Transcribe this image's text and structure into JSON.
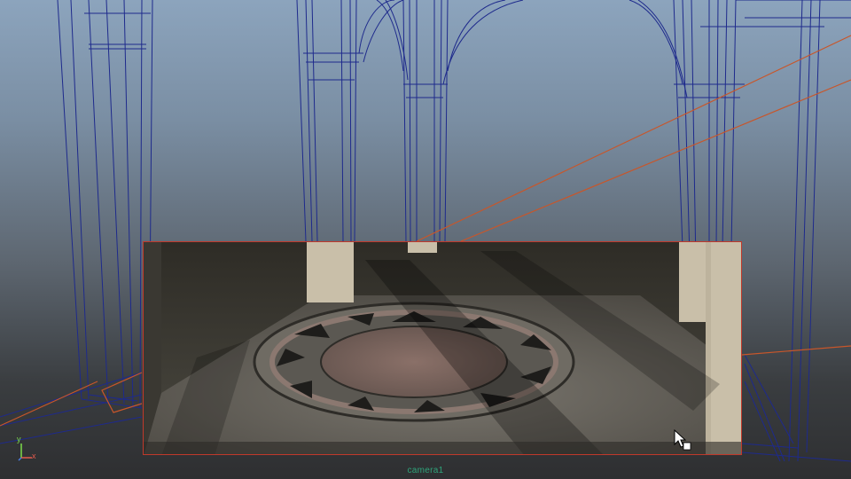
{
  "viewport": {
    "camera_label": "camera1",
    "axis": {
      "y_label": "y",
      "x_label": "x"
    },
    "colors": {
      "wireframe": "#1e2a8c",
      "camera_frustum": "#c8562a",
      "render_border": "#c0392b",
      "camera_label": "#2fa37a"
    }
  },
  "render_region": {
    "content": "floor-mosaic-render"
  }
}
